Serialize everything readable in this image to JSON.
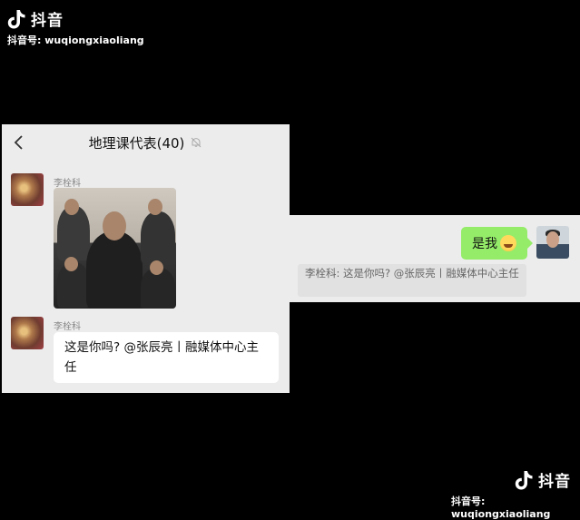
{
  "watermark": {
    "brand": "抖音",
    "account": "抖音号: wuqiongxiaoliang"
  },
  "chat": {
    "title": "地理课代表(40)",
    "messages": [
      {
        "sender": "李栓科",
        "type": "image"
      },
      {
        "sender": "李栓科",
        "text": "这是你吗? @张辰亮丨融媒体中心主任"
      }
    ]
  },
  "reply": {
    "text": "是我",
    "emoji": "grinning-tears-emoji",
    "quote": "李栓科: 这是你吗? @张辰亮丨融媒体中心主任"
  }
}
